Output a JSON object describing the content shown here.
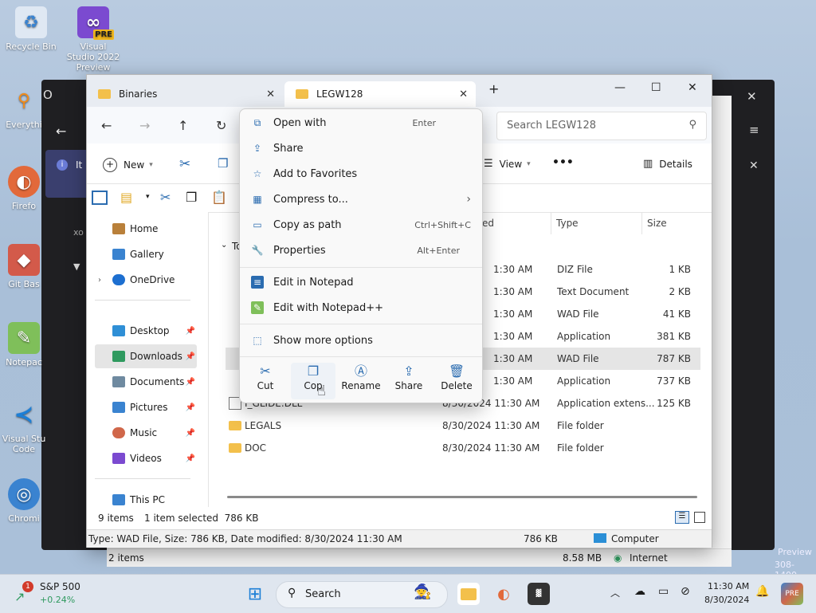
{
  "desktop": {
    "icons": [
      {
        "label": "Recycle Bin"
      },
      {
        "label": "Visual Studio 2022 Preview",
        "badge": "PRE"
      },
      {
        "label": "Everythi"
      },
      {
        "label": "Firefo"
      },
      {
        "label": "Git Bas"
      },
      {
        "label": "Notepac"
      },
      {
        "label": "Visual Stu Code"
      },
      {
        "label": "Chromi"
      }
    ],
    "watermark": "Preview",
    "watermark2": "308-1400"
  },
  "bg_window": {
    "info_text": "It",
    "side_text": "xo",
    "status_items": "2 items",
    "status_size": "8.58 MB",
    "status_zone": "Internet"
  },
  "explorer": {
    "tabs": [
      {
        "label": "Binaries",
        "active": false
      },
      {
        "label": "LEGW128",
        "active": true
      }
    ],
    "new_tab": "+",
    "search_placeholder": "Search LEGW128",
    "toolbar": {
      "new_label": "New",
      "view_label": "View",
      "more_label": "•••",
      "details_label": "Details"
    },
    "sidebar": [
      {
        "label": "Home",
        "color": "#b9803a"
      },
      {
        "label": "Gallery",
        "color": "#3a83d0"
      },
      {
        "label": "OneDrive",
        "color": "#1d6fd0"
      },
      {
        "label": "Desktop",
        "color": "#2f8fd6",
        "pin": true
      },
      {
        "label": "Downloads",
        "color": "#2f9a5f",
        "pin": true,
        "selected": true
      },
      {
        "label": "Documents",
        "color": "#6f8aa0",
        "pin": true
      },
      {
        "label": "Pictures",
        "color": "#3a83d0",
        "pin": true
      },
      {
        "label": "Music",
        "color": "#d0674a",
        "pin": true
      },
      {
        "label": "Videos",
        "color": "#7b4ad0",
        "pin": true
      },
      {
        "label": "This PC",
        "color": "#3a83d0"
      }
    ],
    "group_header": "To",
    "columns": {
      "modified": "ed",
      "type": "Type",
      "size": "Size",
      "extra": "Si"
    },
    "files": [
      {
        "name": "",
        "date": "1:30 AM",
        "type": "DIZ File",
        "size": "1 KB"
      },
      {
        "name": "",
        "date": "1:30 AM",
        "type": "Text Document",
        "size": "2 KB"
      },
      {
        "name": "",
        "date": "1:30 AM",
        "type": "WAD File",
        "size": "41 KB"
      },
      {
        "name": "",
        "date": "1:30 AM",
        "type": "Application",
        "size": "381 KB"
      },
      {
        "name": "",
        "date": "1:30 AM",
        "type": "WAD File",
        "size": "787 KB",
        "selected": true
      },
      {
        "name": "",
        "date": "1:30 AM",
        "type": "Application",
        "size": "737 KB"
      },
      {
        "name": "I_GLIDE.DLL",
        "date": "8/30/2024 11:30 AM",
        "type": "Application extens...",
        "size": "125 KB"
      },
      {
        "name": "LEGALS",
        "date": "8/30/2024 11:30 AM",
        "type": "File folder",
        "size": ""
      },
      {
        "name": "DOC",
        "date": "8/30/2024 11:30 AM",
        "type": "File folder",
        "size": ""
      }
    ],
    "status": {
      "count": "9 items",
      "selected": "1 item selected  786 KB"
    },
    "details_bar": {
      "info": "Type: WAD File, Size: 786 KB, Date modified: 8/30/2024 11:30 AM",
      "size": "786 KB",
      "location": "Computer"
    }
  },
  "context_menu": {
    "items": [
      {
        "label": "Open with",
        "shortcut": "Enter",
        "icon": "open-with-icon"
      },
      {
        "label": "Share",
        "shortcut": "",
        "icon": "share-icon"
      },
      {
        "label": "Add to Favorites",
        "shortcut": "",
        "icon": "star-icon"
      },
      {
        "label": "Compress to...",
        "shortcut": "›",
        "icon": "zip-icon"
      },
      {
        "label": "Copy as path",
        "shortcut": "Ctrl+Shift+C",
        "icon": "path-icon"
      },
      {
        "label": "Properties",
        "shortcut": "Alt+Enter",
        "icon": "wrench-icon"
      }
    ],
    "items2": [
      {
        "label": "Edit in Notepad",
        "icon": "notepad-icon"
      },
      {
        "label": "Edit with Notepad++",
        "icon": "notepadpp-icon"
      }
    ],
    "more": {
      "label": "Show more options",
      "icon": "more-options-icon"
    },
    "actions": [
      {
        "label": "Cut",
        "icon": "scissors-icon"
      },
      {
        "label": "Cop",
        "icon": "copy-icon"
      },
      {
        "label": "Rename",
        "icon": "rename-icon"
      },
      {
        "label": "Share",
        "icon": "share-icon"
      },
      {
        "label": "Delete",
        "icon": "trash-icon"
      }
    ]
  },
  "taskbar": {
    "stock_name": "S&P 500",
    "stock_change": "+0.24%",
    "stock_badge": "1",
    "search_label": "Search",
    "time": "11:30 AM",
    "date": "8/30/2024"
  }
}
